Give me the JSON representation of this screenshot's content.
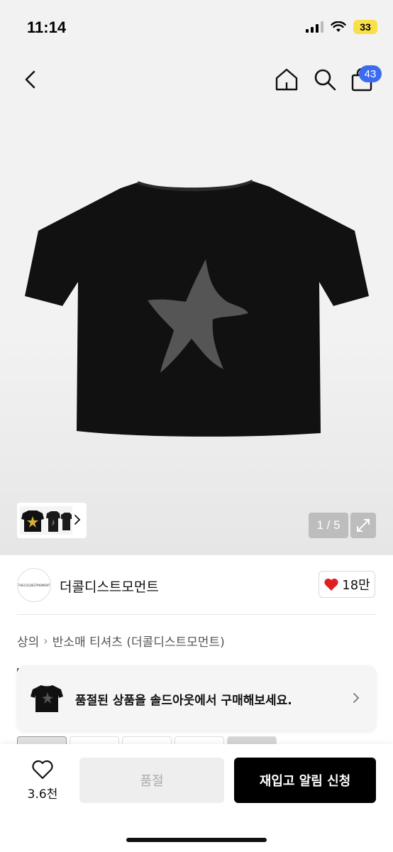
{
  "status_bar": {
    "time": "11:14",
    "battery": "33",
    "battery_color": "#f7e048"
  },
  "nav": {
    "back_icon": "chevron-left-icon",
    "home_icon": "home-icon",
    "search_icon": "search-icon",
    "cart_icon": "shopping-bag-icon",
    "cart_count": "43",
    "badge_color": "#3b6bf0"
  },
  "gallery": {
    "counter": "1 / 5",
    "expand_icon": "expand-icon",
    "thumb_chevron_icon": "chevron-right-icon"
  },
  "brand": {
    "name": "더콜디스트모먼트",
    "logo_text": "THECOLDESTMOMENT",
    "likes": "18만",
    "like_icon": "heart-icon",
    "like_color": "#e02020"
  },
  "breadcrumb": {
    "items": [
      "상의",
      "반소매 티셔츠 (더콜디스트모먼트)"
    ]
  },
  "soldout_banner": {
    "text": "품절된 상품을 솔드아웃에서 구매해보세요."
  },
  "bottom_bar": {
    "wish_count": "3.6천",
    "soldout_label": "품절",
    "restock_label": "재입고 알림 신청"
  }
}
